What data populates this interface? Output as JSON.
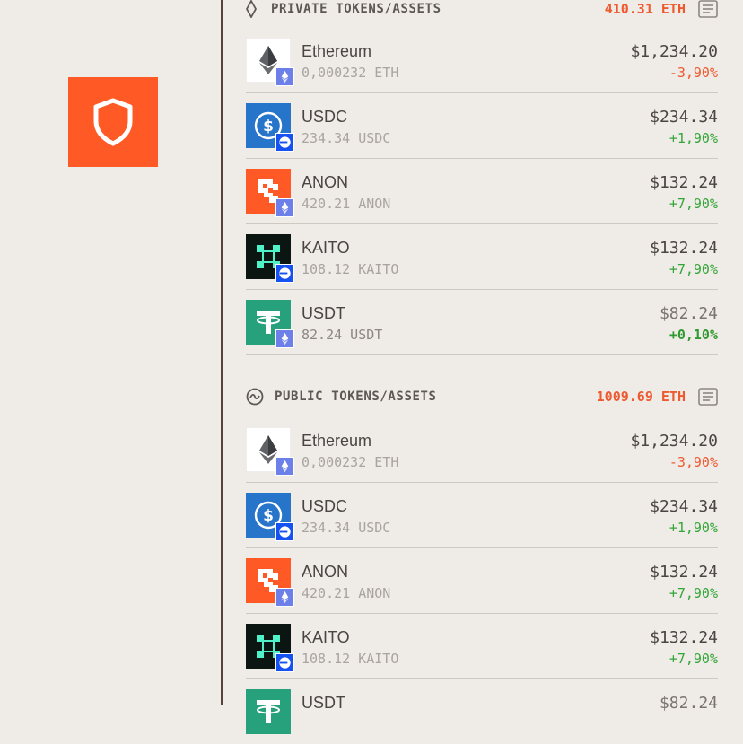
{
  "colors": {
    "accent": "#ff5a25",
    "negative": "#ee5a30",
    "positive": "#33a638",
    "background": "#efebe7"
  },
  "logo": {
    "icon": "shield-icon"
  },
  "sections": [
    {
      "title": "PRIVATE TOKENS/ASSETS",
      "icon": "diamond-icon",
      "total": "410.31 ETH",
      "tokens": [
        {
          "name": "Ethereum",
          "amount": "0,000232 ETH",
          "usd": "$1,234.20",
          "change": "-3,90%",
          "trend": "negative",
          "icon": "ethereum-icon",
          "chain": "ethereum-chain-icon"
        },
        {
          "name": "USDC",
          "amount": "234.34 USDC",
          "usd": "$234.34",
          "change": "+1,90%",
          "trend": "positive",
          "icon": "usdc-icon",
          "chain": "base-chain-icon"
        },
        {
          "name": "ANON",
          "amount": "420.21 ANON",
          "usd": "$132.24",
          "change": "+7,90%",
          "trend": "positive",
          "icon": "anon-icon",
          "chain": "ethereum-chain-icon"
        },
        {
          "name": "KAITO",
          "amount": "108.12 KAITO",
          "usd": "$132.24",
          "change": "+7,90%",
          "trend": "positive",
          "icon": "kaito-icon",
          "chain": "base-chain-icon"
        },
        {
          "name": "USDT",
          "amount": "82.24 USDT",
          "usd": "$82.24",
          "change": "+0,10%",
          "trend": "positive-strong",
          "icon": "usdt-icon",
          "chain": "ethereum-chain-icon"
        }
      ]
    },
    {
      "title": "PUBLIC TOKENS/ASSETS",
      "icon": "wave-circle-icon",
      "total": "1009.69 ETH",
      "tokens": [
        {
          "name": "Ethereum",
          "amount": "0,000232 ETH",
          "usd": "$1,234.20",
          "change": "-3,90%",
          "trend": "negative",
          "icon": "ethereum-icon",
          "chain": "ethereum-chain-icon"
        },
        {
          "name": "USDC",
          "amount": "234.34 USDC",
          "usd": "$234.34",
          "change": "+1,90%",
          "trend": "positive",
          "icon": "usdc-icon",
          "chain": "base-chain-icon"
        },
        {
          "name": "ANON",
          "amount": "420.21 ANON",
          "usd": "$132.24",
          "change": "+7,90%",
          "trend": "positive",
          "icon": "anon-icon",
          "chain": "ethereum-chain-icon"
        },
        {
          "name": "KAITO",
          "amount": "108.12 KAITO",
          "usd": "$132.24",
          "change": "+7,90%",
          "trend": "positive",
          "icon": "kaito-icon",
          "chain": "base-chain-icon"
        },
        {
          "name": "USDT",
          "amount": "",
          "usd": "$82.24",
          "change": "",
          "trend": "positive",
          "icon": "usdt-icon",
          "chain": "ethereum-chain-icon"
        }
      ]
    }
  ]
}
